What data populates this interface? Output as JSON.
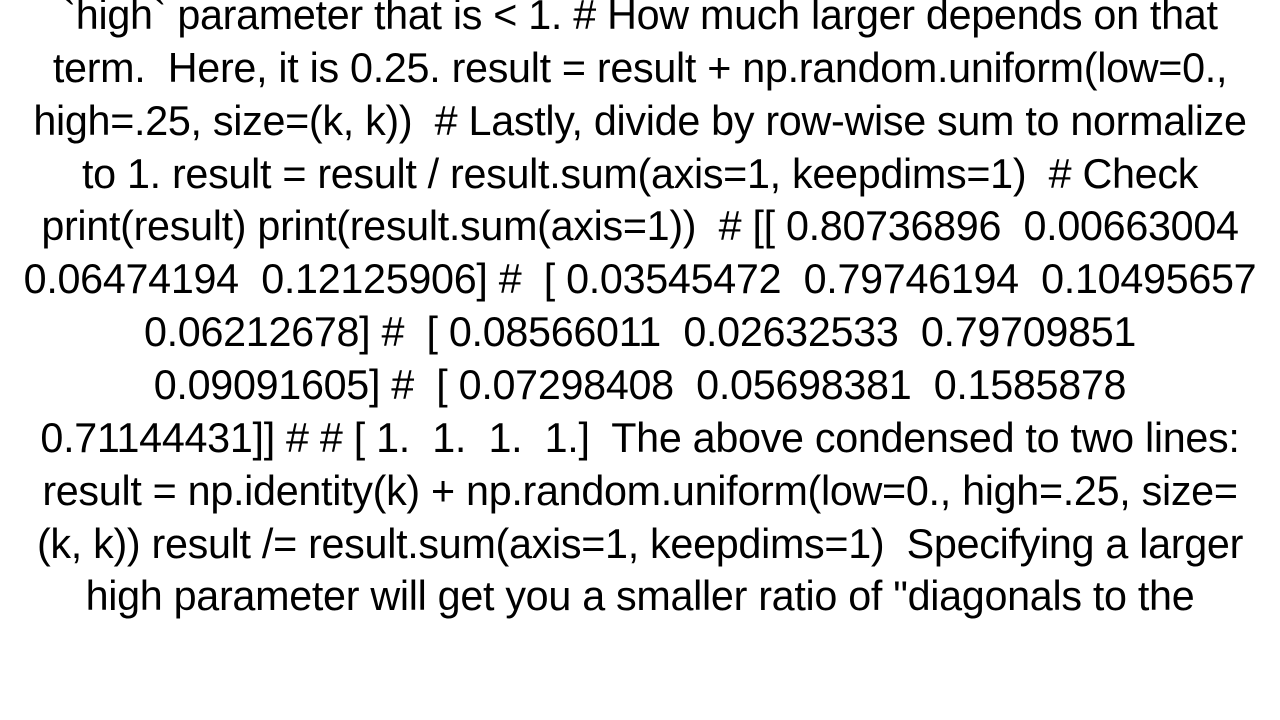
{
  "body": "`high` parameter that is < 1. # How much larger depends on that term.  Here, it is 0.25. result = result + np.random.uniform(low=0., high=.25, size=(k, k))  # Lastly, divide by row-wise sum to normalize to 1. result = result / result.sum(axis=1, keepdims=1)  # Check print(result) print(result.sum(axis=1))  # [[ 0.80736896  0.00663004  0.06474194  0.12125906] #  [ 0.03545472  0.79746194  0.10495657  0.06212678] #  [ 0.08566011  0.02632533  0.79709851  0.09091605] #  [ 0.07298408  0.05698381  0.1585878   0.71144431]] # # [ 1.  1.  1.  1.]  The above condensed to two lines: result = np.identity(k) + np.random.uniform(low=0., high=.25, size=(k, k)) result /= result.sum(axis=1, keepdims=1)  Specifying a larger high parameter will get you a smaller ratio of \"diagonals to the"
}
